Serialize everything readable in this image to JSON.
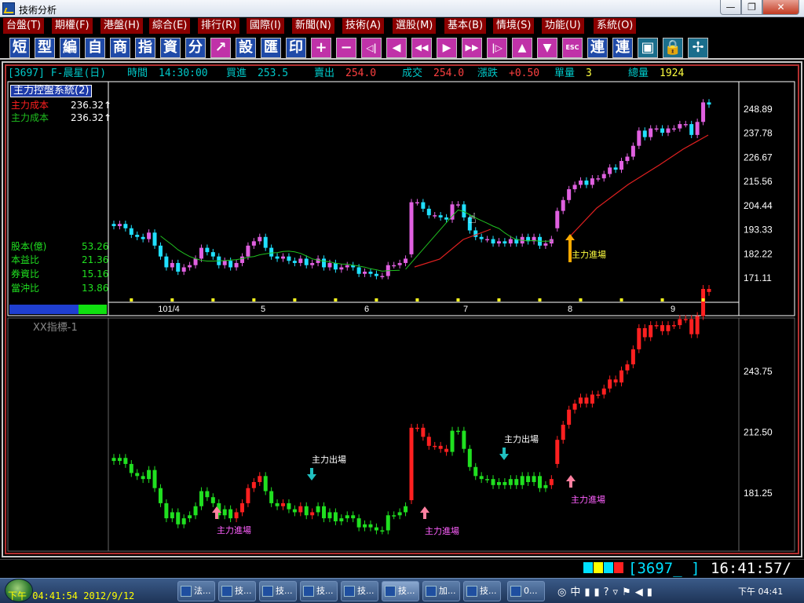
{
  "window": {
    "title": "技術分析",
    "min": "—",
    "max": "❐",
    "close": "✕"
  },
  "menu": [
    "台盤(T)",
    "期權(F)",
    "港盤(H)",
    "綜合(E)",
    "排行(R)",
    "國際(I)",
    "新聞(N)",
    "技術(A)",
    "選股(M)",
    "基本(B)",
    "情境(S)",
    "功能(U)",
    "系統(O)"
  ],
  "toolbar": {
    "chars": [
      "短",
      "型",
      "編",
      "自",
      "商",
      "指",
      "資",
      "分",
      "↗",
      "設",
      "匯",
      "印"
    ],
    "symbols": [
      "+",
      "−",
      "◁|",
      "◀",
      "◀◀",
      "▶",
      "▶▶",
      "|▷",
      "▲",
      "▼",
      "ESC"
    ],
    "chars2": [
      "連",
      "連"
    ],
    "icons": [
      "window-icon",
      "lock-icon",
      "fan-icon"
    ]
  },
  "quote": {
    "symbol": "[3697] F-晨星(日)",
    "time_label": "時間",
    "time": "14:30:00",
    "bid_label": "買進",
    "bid": "253.5",
    "ask_label": "賣出",
    "ask": "254.0",
    "trade_label": "成交",
    "trade": "254.0",
    "chg_label": "漲跌",
    "chg": "+0.50",
    "vol_label": "單量",
    "vol": "3",
    "tvol_label": "總量",
    "tvol": "1924"
  },
  "panel_top": {
    "system": "主力控盤系統(2)",
    "cost1_label": "主力成本",
    "cost1": "236.32↑",
    "cost2_label": "主力成本",
    "cost2": "236.32↑",
    "fund": [
      {
        "label": "股本(億)",
        "value": "53.26"
      },
      {
        "label": "本益比",
        "value": "21.36"
      },
      {
        "label": "券資比",
        "value": "15.16"
      },
      {
        "label": "當沖比",
        "value": "13.86"
      }
    ]
  },
  "panel_bottom": {
    "title": "XX指標-1"
  },
  "colors": {
    "up": "#e060e0",
    "down": "#20e0ff",
    "ma": "#20c020",
    "cost": "#e02020",
    "ind_up": "#ff2020",
    "ind_down": "#20e020"
  },
  "chart_data": [
    {
      "type": "candlestick",
      "name": "price",
      "y_ticks": [
        248.89,
        237.78,
        226.67,
        215.56,
        204.44,
        193.33,
        182.22,
        171.11
      ],
      "x_ticks": [
        "101/4",
        "5",
        "6",
        "7",
        "8",
        "9"
      ],
      "annotations": [
        "主力進場"
      ],
      "closes": [
        195,
        196,
        194,
        191,
        190,
        189,
        192,
        186,
        181,
        176,
        178,
        174,
        176,
        177,
        180,
        185,
        183,
        181,
        177,
        179,
        176,
        178,
        181,
        186,
        188,
        190,
        185,
        181,
        180,
        181,
        179,
        178,
        180,
        177,
        178,
        180,
        176,
        178,
        175,
        176,
        177,
        176,
        173,
        174,
        173,
        172,
        172,
        177,
        177,
        178,
        180,
        206,
        206,
        203,
        200,
        200,
        199,
        198,
        205,
        205,
        199,
        193,
        190,
        189,
        189,
        187,
        188,
        187,
        189,
        187,
        190,
        188,
        190,
        186,
        187,
        189,
        202,
        207,
        212,
        214,
        216,
        214,
        217,
        217,
        219,
        222,
        221,
        225,
        227,
        232,
        239,
        236,
        240,
        240,
        238,
        240,
        240,
        242,
        242,
        237,
        243,
        252,
        251
      ],
      "ma_line": "from start to 7 (green)",
      "cost_line": "from 7 to 9 (red)"
    },
    {
      "type": "candlestick",
      "name": "XX指標-1",
      "y_ticks": [
        243.75,
        212.5,
        181.25
      ],
      "annotations": [
        "主力出場",
        "主力進場"
      ]
    }
  ],
  "status": {
    "code": "[3697_ ]",
    "time": "16:41:57/"
  },
  "taskbar": {
    "datetime": "下午 04:41:54 2012/9/12",
    "tasks": [
      "法...",
      "技...",
      "技...",
      "技...",
      "技...",
      "技...",
      "加...",
      "技...",
      "0..."
    ],
    "clock": "下午 04:41"
  }
}
